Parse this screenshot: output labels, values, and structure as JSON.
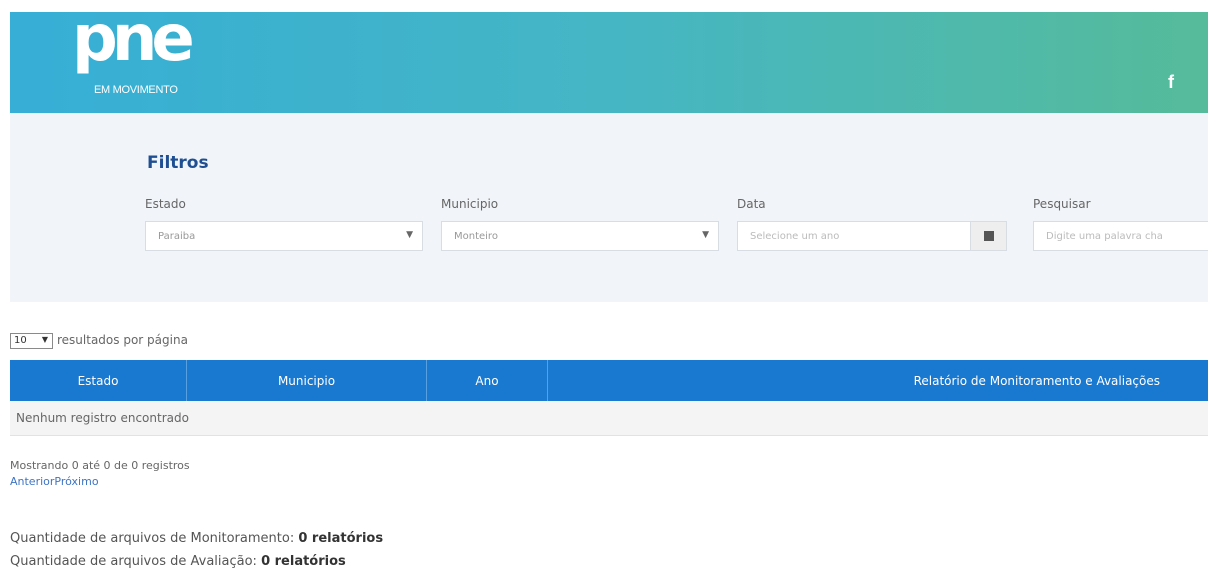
{
  "header": {
    "logo_text": "pne",
    "logo_subtitle": "EM MOVIMENTO",
    "facebook_icon": "f"
  },
  "filters": {
    "title": "Filtros",
    "estado": {
      "label": "Estado",
      "value": "Paraiba"
    },
    "municipio": {
      "label": "Municipio",
      "value": "Monteiro"
    },
    "data": {
      "label": "Data",
      "placeholder": "Selecione um ano"
    },
    "pesquisar": {
      "label": "Pesquisar",
      "placeholder": "Digite uma palavra cha"
    }
  },
  "pagination_top": {
    "per_page_value": "10",
    "per_page_label": "resultados por página"
  },
  "table": {
    "columns": [
      "Estado",
      "Municipio",
      "Ano",
      "Relatório de Monitoramento e Avaliações"
    ],
    "empty_message": "Nenhum registro encontrado"
  },
  "pagination_bottom": {
    "info": "Mostrando 0 até 0 de 0 registros",
    "previous": "Anterior",
    "next": "Próximo"
  },
  "summary": {
    "monitoramento_label": "Quantidade de arquivos de Monitoramento:",
    "monitoramento_value": "0 relatórios",
    "avaliacao_label": "Quantidade de arquivos de Avaliação:",
    "avaliacao_value": "0 relatórios"
  },
  "colors": {
    "header_gradient_start": "#36aed6",
    "header_gradient_end": "#56bb9a",
    "table_header": "#1978cf",
    "filters_title": "#1f4f92",
    "link": "#3d74c4"
  }
}
